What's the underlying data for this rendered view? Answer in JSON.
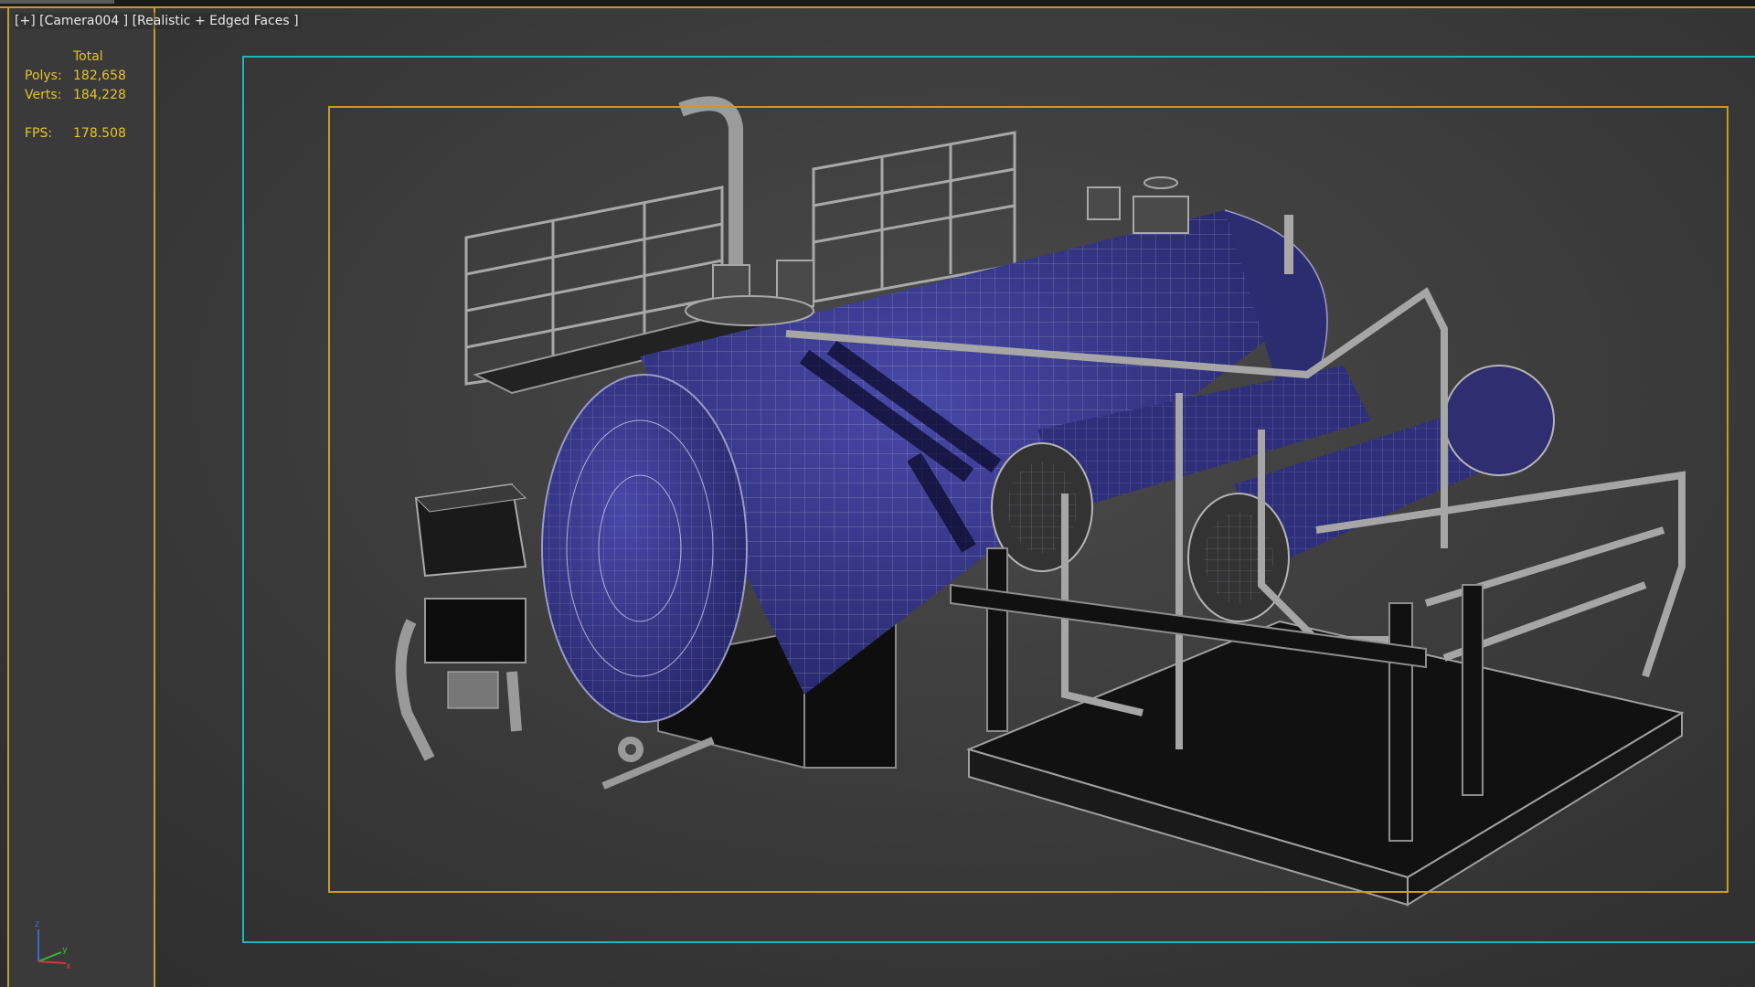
{
  "viewport": {
    "label": "[+] [Camera004 ] [Realistic + Edged Faces ]"
  },
  "stats": {
    "header": "Total",
    "polys_label": "Polys:",
    "polys_value": "182,658",
    "verts_label": "Verts:",
    "verts_value": "184,228",
    "fps_label": "FPS:",
    "fps_value": "178.508"
  },
  "axis": {
    "z": "z",
    "y": "y",
    "x": "x"
  },
  "colors": {
    "stats_text": "#e6c42a",
    "render_frame": "#c79a2a",
    "safe_frame": "#23b3b8",
    "tank_blue": "#3a3a8c",
    "wire": "#b9b9b9",
    "axis_x": "#d23a3a",
    "axis_y": "#3ab83a",
    "axis_z": "#3a6ad2"
  }
}
